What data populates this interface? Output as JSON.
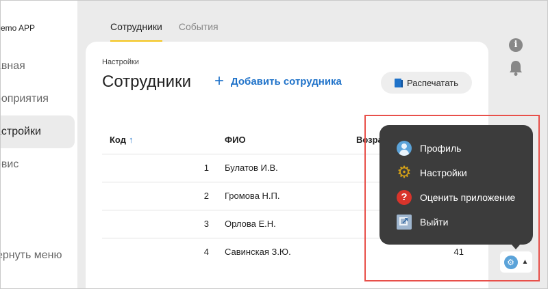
{
  "app": {
    "brand": "emo APP"
  },
  "sidebar": {
    "items": [
      {
        "label": "авная"
      },
      {
        "label": "роприятия"
      },
      {
        "label": "астройки"
      },
      {
        "label": "рвис"
      }
    ],
    "collapse_label": "ернуть меню"
  },
  "tabs": [
    {
      "label": "Сотрудники"
    },
    {
      "label": "События"
    }
  ],
  "page": {
    "breadcrumb": "Настройки",
    "title": "Сотрудники",
    "add_button": "Добавить сотрудника",
    "print_button": "Распечатать"
  },
  "table": {
    "columns": [
      "Код",
      "ФИО",
      "Возра"
    ],
    "sort_indicator": "↑",
    "rows": [
      {
        "code": "1",
        "name": "Булатов И.В.",
        "age": ""
      },
      {
        "code": "2",
        "name": "Громова Н.П.",
        "age": ""
      },
      {
        "code": "3",
        "name": "Орлова Е.Н.",
        "age": ""
      },
      {
        "code": "4",
        "name": "Савинская З.Ю.",
        "age": "41"
      }
    ]
  },
  "user_menu": {
    "items": [
      {
        "label": "Профиль",
        "icon": "profile-icon"
      },
      {
        "label": "Настройки",
        "icon": "gear-icon"
      },
      {
        "label": "Оценить приложение",
        "icon": "help-icon"
      },
      {
        "label": "Выйти",
        "icon": "exit-icon"
      }
    ]
  },
  "colors": {
    "accent": "#1f72c9",
    "tab_underline": "#f5c518",
    "popup_bg": "#3c3c3c",
    "highlight": "#e8504a"
  }
}
